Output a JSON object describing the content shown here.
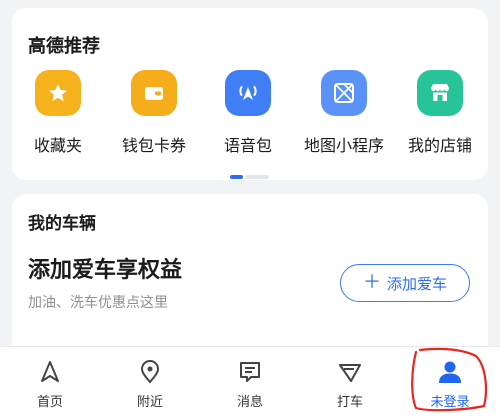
{
  "recommend": {
    "title": "高德推荐",
    "items": [
      {
        "label": "收藏夹",
        "icon": "star-icon",
        "color": "#f5b21c"
      },
      {
        "label": "钱包卡券",
        "icon": "wallet-icon",
        "color": "#f5ad1c"
      },
      {
        "label": "语音包",
        "icon": "voice-pack-icon",
        "color": "#3f7ef5"
      },
      {
        "label": "地图小程序",
        "icon": "mini-program-icon",
        "color": "#5a92f7"
      },
      {
        "label": "我的店铺",
        "icon": "store-icon",
        "color": "#27c49a"
      }
    ],
    "pager": {
      "active_color": "#2f6df0"
    }
  },
  "vehicle": {
    "title": "我的车辆",
    "headline": "添加爱车享权益",
    "subtitle": "加油、洗车优惠点这里",
    "add_button": {
      "icon": "plus-icon",
      "label": "添加爱车"
    }
  },
  "tabs": [
    {
      "label": "首页",
      "icon": "navigation-arrow-icon"
    },
    {
      "label": "附近",
      "icon": "location-pin-icon"
    },
    {
      "label": "消息",
      "icon": "message-icon"
    },
    {
      "label": "打车",
      "icon": "taxi-icon"
    },
    {
      "label": "未登录",
      "icon": "user-icon",
      "active_color": "#1f66f0"
    }
  ],
  "annotation": {
    "color": "#e8261f"
  }
}
